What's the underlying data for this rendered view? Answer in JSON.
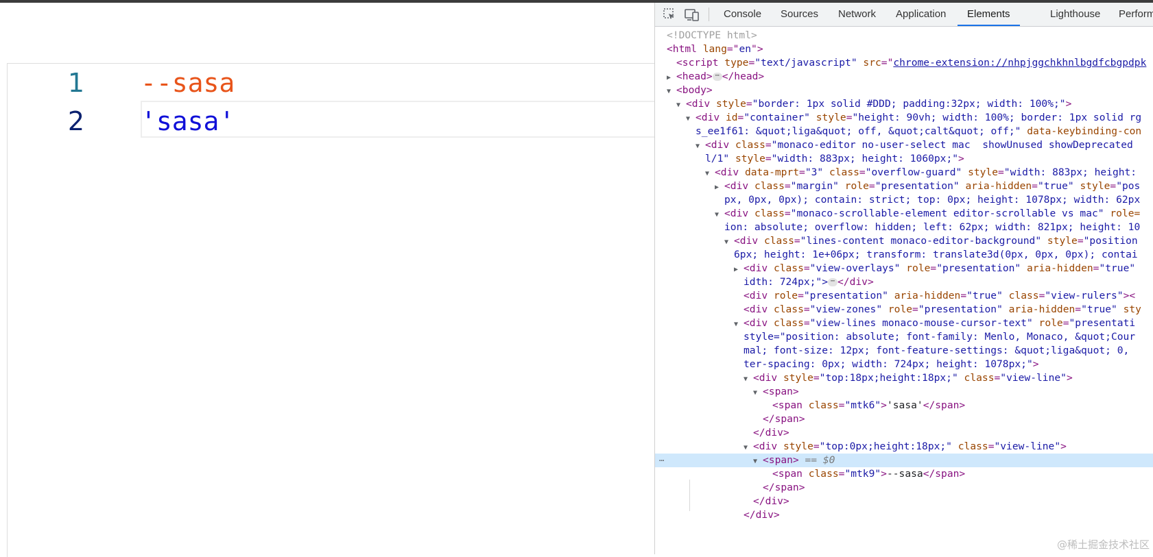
{
  "editor": {
    "lines": [
      {
        "number": "1",
        "code": "--sasa"
      },
      {
        "number": "2",
        "code": "'sasa'"
      }
    ],
    "colors": {
      "line1_number": "#237893",
      "line2_number": "#0b216f",
      "comment_token": "#e8541a",
      "string_token": "#1010d8"
    }
  },
  "devtools": {
    "toolbar": {
      "icons": [
        "inspect-element-icon",
        "device-toolbar-icon"
      ],
      "tabs": [
        "Console",
        "Sources",
        "Network",
        "Application",
        "Elements",
        "Lighthouse",
        "Performance"
      ],
      "active_tab": "Elements"
    },
    "dom": {
      "doctype": "<!DOCTYPE html>",
      "html_open": [
        "<html ",
        "lang",
        "=\"",
        "en",
        "\">"
      ],
      "script_line": {
        "tag": "<script ",
        "attr1": "type",
        "val1": "\"text/javascript\"",
        "attr2": " src",
        "eq": "=\"",
        "link": "chrome-extension://nhpjggchkhnlbgdfcbgpdpk"
      },
      "head": {
        "open": "<head>",
        "close": "</head>"
      },
      "body": "<body>",
      "div_border": {
        "tag": "<div ",
        "attr": "style",
        "val": "\"border: 1px solid #DDD; padding:32px; width: 100%;\"",
        "end": ">"
      },
      "container_1": {
        "tag": "<div ",
        "attr1": "id",
        "val1": "\"container\"",
        "attr2": " style",
        "val2": "\"height: 90vh; width: 100%; border: 1px solid rg"
      },
      "container_2": {
        "val": "s_ee1f61: &quot;liga&quot; off, &quot;calt&quot; off;\"",
        "attr": " data-keybinding-con"
      },
      "monaco_1": {
        "tag": "<div ",
        "attr": "class",
        "val": "\"monaco-editor no-user-select mac  showUnused showDeprecated"
      },
      "monaco_2": {
        "val_a": "l/1\"",
        "attr": " style",
        "val": "\"width: 883px; height: 1060px;\"",
        "end": ">"
      },
      "guard": {
        "tag": "<div ",
        "attr1": "data-mprt",
        "val1": "\"3\"",
        "attr2": " class",
        "val2": "\"overflow-guard\"",
        "attr3": " style",
        "val3": "\"width: 883px; height:"
      },
      "margin_1": {
        "tag": "<div ",
        "attr1": "class",
        "val1": "\"margin\"",
        "attr2": " role",
        "val2": "\"presentation\"",
        "attr3": " aria-hidden",
        "val3": "\"true\"",
        "attr4": " style",
        "val4": "\"pos"
      },
      "margin_2": {
        "val": "px, 0px, 0px); contain: strict; top: 0px; height: 1078px; width: 62px"
      },
      "scrollable_1": {
        "tag": "<div ",
        "attr1": "class",
        "val1": "\"monaco-scrollable-element editor-scrollable vs mac\"",
        "attr2": " role="
      },
      "scrollable_2": {
        "val": "ion: absolute; overflow: hidden; left: 62px; width: 821px; height: 10"
      },
      "lines_content_1": {
        "tag": "<div ",
        "attr1": "class",
        "val1": "\"lines-content monaco-editor-background\"",
        "attr2": " style",
        "val2": "\"position"
      },
      "lines_content_2": {
        "val": "6px; height: 1e+06px; transform: translate3d(0px, 0px, 0px); contai"
      },
      "overlays_1": {
        "tag": "<div ",
        "attr1": "class",
        "val1": "\"view-overlays\"",
        "attr2": " role",
        "val2": "\"presentation\"",
        "attr3": " aria-hidden",
        "val3": "\"true\""
      },
      "overlays_2": {
        "val": "idth: 724px;\">",
        "ell": "⋯",
        "close": "</div>"
      },
      "rulers": {
        "tag": "<div ",
        "attr1": "role",
        "val1": "\"presentation\"",
        "attr2": " aria-hidden",
        "val2": "\"true\"",
        "attr3": " class",
        "val3": "\"view-rulers\"",
        "end": "><"
      },
      "zones": {
        "tag": "<div ",
        "attr1": "class",
        "val1": "\"view-zones\"",
        "attr2": " role",
        "val2": "\"presentation\"",
        "attr3": " aria-hidden",
        "val3": "\"true\"",
        "attr4": " sty"
      },
      "view_lines_1": {
        "tag": "<div ",
        "attr1": "class",
        "val1": "\"view-lines monaco-mouse-cursor-text\"",
        "attr2": " role",
        "val2": "\"presentati"
      },
      "view_lines_2": {
        "val": "style=\"position: absolute; font-family: Menlo, Monaco, &quot;Cour"
      },
      "view_lines_3": {
        "val": "mal; font-size: 12px; font-feature-settings: &quot;liga&quot; 0, "
      },
      "view_lines_4": {
        "val": "ter-spacing: 0px; width: 724px; height: 1078px;\"",
        "end": ">"
      },
      "vl_a": {
        "tag": "<div ",
        "attr1": "style",
        "val1": "\"top:18px;height:18px;\"",
        "attr2": " class",
        "val2": "\"view-line\"",
        "end": ">"
      },
      "span_open": "<span>",
      "mtk6": {
        "tag": "<span ",
        "attr": "class",
        "val": "\"mtk6\"",
        "end": ">",
        "text": "'sasa'",
        "close": "</span>"
      },
      "span_close": "</span>",
      "div_close": "</div>",
      "vl_b": {
        "tag": "<div ",
        "attr1": "style",
        "val1": "\"top:0px;height:18px;\"",
        "attr2": " class",
        "val2": "\"view-line\"",
        "end": ">"
      },
      "selected": {
        "tag": "<span>",
        "marker": " == $0",
        "dots": "⋯"
      },
      "mtk9": {
        "tag": "<span ",
        "attr": "class",
        "val": "\"mtk9\"",
        "end": ">",
        "text": "--sasa",
        "close": "</span>"
      },
      "last_div_close": "</div>"
    }
  },
  "watermark": "@稀土掘金技术社区"
}
